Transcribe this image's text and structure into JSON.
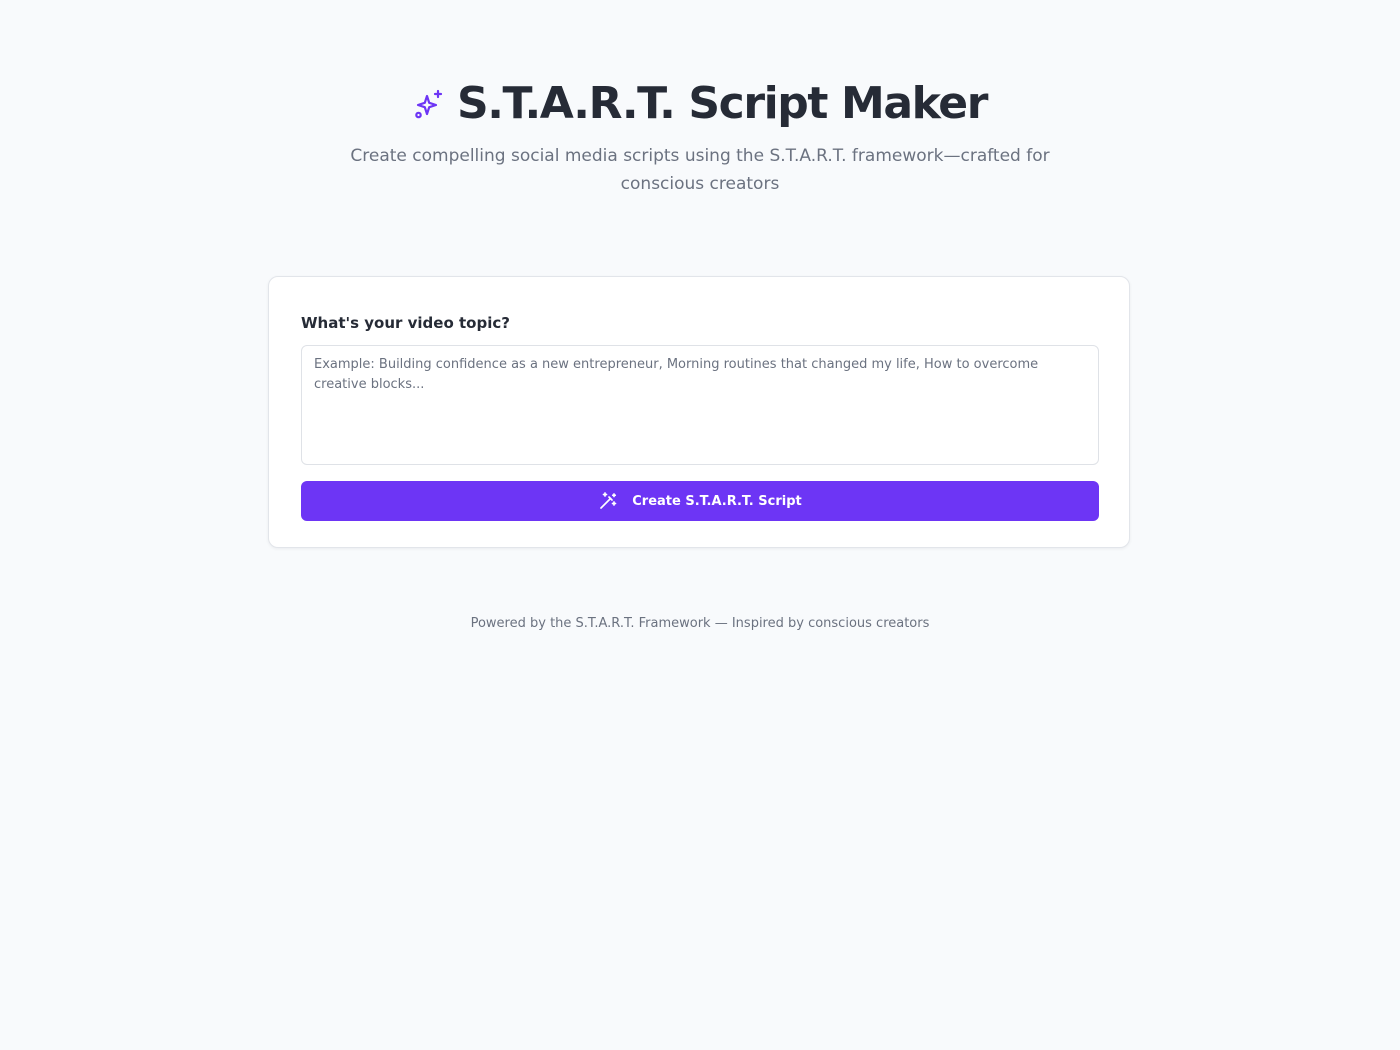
{
  "header": {
    "title": "S.T.A.R.T. Script Maker",
    "subtitle": "Create compelling social media scripts using the S.T.A.R.T. framework—crafted for conscious creators",
    "icon": "sparkles-icon"
  },
  "form": {
    "label": "What's your video topic?",
    "placeholder": "Example: Building confidence as a new entrepreneur, Morning routines that changed my life, How to overcome creative blocks...",
    "value": "",
    "button_label": "Create S.T.A.R.T. Script",
    "button_icon": "magic-wand-icon"
  },
  "footer": {
    "text": "Powered by the S.T.A.R.T. Framework — Inspired by conscious creators"
  },
  "colors": {
    "accent": "#6d35f5",
    "background": "#f8fafc",
    "title": "#262b36",
    "muted": "#6b7280"
  }
}
